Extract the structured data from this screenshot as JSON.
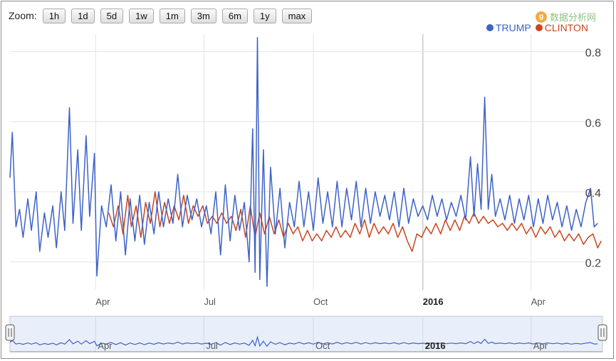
{
  "zoom": {
    "label": "Zoom:",
    "buttons": [
      "1h",
      "1d",
      "5d",
      "1w",
      "1m",
      "3m",
      "6m",
      "1y",
      "max"
    ]
  },
  "watermark": {
    "icon": "g",
    "text": "数据分析网"
  },
  "colors": {
    "trump": "#3d62c8",
    "clinton": "#c8461e",
    "grid": "#e4e4e4",
    "navigator_fill": "#e9effa"
  },
  "chart_data": {
    "type": "line",
    "legend_position": "top-right",
    "grid": true,
    "x_axis": {
      "type": "datetime",
      "range": [
        "2015-01-19",
        "2016-05-31"
      ],
      "ticks": [
        {
          "date": "2015-04-01",
          "label": "Apr",
          "bold": false
        },
        {
          "date": "2015-07-01",
          "label": "Jul",
          "bold": false
        },
        {
          "date": "2015-10-01",
          "label": "Oct",
          "bold": false
        },
        {
          "date": "2016-01-01",
          "label": "2016",
          "bold": true
        },
        {
          "date": "2016-04-01",
          "label": "Apr",
          "bold": false
        }
      ]
    },
    "y_axis": {
      "range": [
        0.12,
        0.85
      ],
      "ticks": [
        0.2,
        0.4,
        0.6,
        0.8
      ],
      "tick_labels": [
        "0.2",
        "0.4",
        "0.6",
        "0.8"
      ]
    },
    "series": [
      {
        "name": "TRUMP",
        "color": "#3d62c8",
        "points": [
          [
            "2015-01-19",
            0.44
          ],
          [
            "2015-01-21",
            0.57
          ],
          [
            "2015-01-24",
            0.3
          ],
          [
            "2015-01-27",
            0.35
          ],
          [
            "2015-01-30",
            0.27
          ],
          [
            "2015-02-03",
            0.38
          ],
          [
            "2015-02-06",
            0.29
          ],
          [
            "2015-02-10",
            0.4
          ],
          [
            "2015-02-13",
            0.23
          ],
          [
            "2015-02-17",
            0.34
          ],
          [
            "2015-02-20",
            0.27
          ],
          [
            "2015-02-24",
            0.36
          ],
          [
            "2015-02-27",
            0.24
          ],
          [
            "2015-03-03",
            0.4
          ],
          [
            "2015-03-06",
            0.29
          ],
          [
            "2015-03-10",
            0.64
          ],
          [
            "2015-03-13",
            0.31
          ],
          [
            "2015-03-17",
            0.52
          ],
          [
            "2015-03-20",
            0.29
          ],
          [
            "2015-03-24",
            0.56
          ],
          [
            "2015-03-27",
            0.33
          ],
          [
            "2015-03-31",
            0.51
          ],
          [
            "2015-04-02",
            0.16
          ],
          [
            "2015-04-06",
            0.36
          ],
          [
            "2015-04-10",
            0.3
          ],
          [
            "2015-04-14",
            0.42
          ],
          [
            "2015-04-18",
            0.26
          ],
          [
            "2015-04-22",
            0.4
          ],
          [
            "2015-04-26",
            0.22
          ],
          [
            "2015-04-30",
            0.38
          ],
          [
            "2015-05-04",
            0.26
          ],
          [
            "2015-05-08",
            0.39
          ],
          [
            "2015-05-12",
            0.25
          ],
          [
            "2015-05-16",
            0.37
          ],
          [
            "2015-05-20",
            0.28
          ],
          [
            "2015-05-24",
            0.4
          ],
          [
            "2015-05-28",
            0.3
          ],
          [
            "2015-06-01",
            0.38
          ],
          [
            "2015-06-05",
            0.31
          ],
          [
            "2015-06-09",
            0.45
          ],
          [
            "2015-06-13",
            0.3
          ],
          [
            "2015-06-17",
            0.39
          ],
          [
            "2015-06-21",
            0.32
          ],
          [
            "2015-06-25",
            0.38
          ],
          [
            "2015-06-29",
            0.3
          ],
          [
            "2015-07-03",
            0.36
          ],
          [
            "2015-07-07",
            0.28
          ],
          [
            "2015-07-11",
            0.4
          ],
          [
            "2015-07-15",
            0.22
          ],
          [
            "2015-07-19",
            0.42
          ],
          [
            "2015-07-23",
            0.26
          ],
          [
            "2015-07-27",
            0.39
          ],
          [
            "2015-07-31",
            0.29
          ],
          [
            "2015-08-04",
            0.37
          ],
          [
            "2015-08-08",
            0.2
          ],
          [
            "2015-08-11",
            0.58
          ],
          [
            "2015-08-13",
            0.17
          ],
          [
            "2015-08-15",
            0.84
          ],
          [
            "2015-08-17",
            0.15
          ],
          [
            "2015-08-20",
            0.52
          ],
          [
            "2015-08-23",
            0.13
          ],
          [
            "2015-08-26",
            0.47
          ],
          [
            "2015-08-30",
            0.28
          ],
          [
            "2015-09-03",
            0.41
          ],
          [
            "2015-09-07",
            0.24
          ],
          [
            "2015-09-11",
            0.37
          ],
          [
            "2015-09-15",
            0.3
          ],
          [
            "2015-09-19",
            0.43
          ],
          [
            "2015-09-23",
            0.3
          ],
          [
            "2015-09-27",
            0.4
          ],
          [
            "2015-10-01",
            0.29
          ],
          [
            "2015-10-05",
            0.44
          ],
          [
            "2015-10-09",
            0.31
          ],
          [
            "2015-10-13",
            0.4
          ],
          [
            "2015-10-17",
            0.3
          ],
          [
            "2015-10-21",
            0.43
          ],
          [
            "2015-10-25",
            0.3
          ],
          [
            "2015-10-29",
            0.41
          ],
          [
            "2015-11-02",
            0.32
          ],
          [
            "2015-11-06",
            0.43
          ],
          [
            "2015-11-10",
            0.3
          ],
          [
            "2015-11-14",
            0.41
          ],
          [
            "2015-11-18",
            0.31
          ],
          [
            "2015-11-22",
            0.4
          ],
          [
            "2015-11-26",
            0.33
          ],
          [
            "2015-11-30",
            0.39
          ],
          [
            "2015-12-04",
            0.32
          ],
          [
            "2015-12-08",
            0.4
          ],
          [
            "2015-12-12",
            0.3
          ],
          [
            "2015-12-16",
            0.41
          ],
          [
            "2015-12-20",
            0.31
          ],
          [
            "2015-12-24",
            0.38
          ],
          [
            "2015-12-28",
            0.33
          ],
          [
            "2016-01-01",
            0.36
          ],
          [
            "2016-01-05",
            0.32
          ],
          [
            "2016-01-09",
            0.39
          ],
          [
            "2016-01-13",
            0.33
          ],
          [
            "2016-01-17",
            0.38
          ],
          [
            "2016-01-21",
            0.32
          ],
          [
            "2016-01-25",
            0.37
          ],
          [
            "2016-01-29",
            0.33
          ],
          [
            "2016-02-02",
            0.39
          ],
          [
            "2016-02-06",
            0.32
          ],
          [
            "2016-02-10",
            0.5
          ],
          [
            "2016-02-13",
            0.33
          ],
          [
            "2016-02-16",
            0.48
          ],
          [
            "2016-02-19",
            0.35
          ],
          [
            "2016-02-22",
            0.67
          ],
          [
            "2016-02-25",
            0.35
          ],
          [
            "2016-02-28",
            0.45
          ],
          [
            "2016-03-02",
            0.33
          ],
          [
            "2016-03-06",
            0.38
          ],
          [
            "2016-03-10",
            0.32
          ],
          [
            "2016-03-14",
            0.39
          ],
          [
            "2016-03-18",
            0.31
          ],
          [
            "2016-03-22",
            0.38
          ],
          [
            "2016-03-26",
            0.32
          ],
          [
            "2016-03-30",
            0.39
          ],
          [
            "2016-04-03",
            0.3
          ],
          [
            "2016-04-07",
            0.38
          ],
          [
            "2016-04-11",
            0.31
          ],
          [
            "2016-04-15",
            0.39
          ],
          [
            "2016-04-19",
            0.32
          ],
          [
            "2016-04-23",
            0.37
          ],
          [
            "2016-04-27",
            0.3
          ],
          [
            "2016-05-01",
            0.36
          ],
          [
            "2016-05-05",
            0.29
          ],
          [
            "2016-05-09",
            0.35
          ],
          [
            "2016-05-13",
            0.3
          ],
          [
            "2016-05-17",
            0.37
          ],
          [
            "2016-05-21",
            0.41
          ],
          [
            "2016-05-24",
            0.3
          ],
          [
            "2016-05-27",
            0.31
          ]
        ]
      },
      {
        "name": "CLINTON",
        "color": "#c8461e",
        "points": [
          [
            "2015-04-12",
            0.34
          ],
          [
            "2015-04-16",
            0.3
          ],
          [
            "2015-04-20",
            0.36
          ],
          [
            "2015-04-24",
            0.28
          ],
          [
            "2015-04-28",
            0.39
          ],
          [
            "2015-05-01",
            0.3
          ],
          [
            "2015-05-05",
            0.36
          ],
          [
            "2015-05-09",
            0.27
          ],
          [
            "2015-05-13",
            0.37
          ],
          [
            "2015-05-17",
            0.31
          ],
          [
            "2015-05-21",
            0.4
          ],
          [
            "2015-05-25",
            0.3
          ],
          [
            "2015-05-29",
            0.37
          ],
          [
            "2015-06-02",
            0.31
          ],
          [
            "2015-06-06",
            0.36
          ],
          [
            "2015-06-10",
            0.32
          ],
          [
            "2015-06-14",
            0.39
          ],
          [
            "2015-06-18",
            0.31
          ],
          [
            "2015-06-22",
            0.36
          ],
          [
            "2015-06-26",
            0.33
          ],
          [
            "2015-06-30",
            0.36
          ],
          [
            "2015-07-04",
            0.31
          ],
          [
            "2015-07-08",
            0.33
          ],
          [
            "2015-07-12",
            0.31
          ],
          [
            "2015-07-16",
            0.34
          ],
          [
            "2015-07-20",
            0.31
          ],
          [
            "2015-07-24",
            0.33
          ],
          [
            "2015-07-28",
            0.29
          ],
          [
            "2015-08-01",
            0.35
          ],
          [
            "2015-08-05",
            0.27
          ],
          [
            "2015-08-09",
            0.36
          ],
          [
            "2015-08-13",
            0.27
          ],
          [
            "2015-08-17",
            0.34
          ],
          [
            "2015-08-21",
            0.28
          ],
          [
            "2015-08-25",
            0.33
          ],
          [
            "2015-08-29",
            0.28
          ],
          [
            "2015-09-02",
            0.32
          ],
          [
            "2015-09-06",
            0.27
          ],
          [
            "2015-09-10",
            0.31
          ],
          [
            "2015-09-14",
            0.28
          ],
          [
            "2015-09-18",
            0.3
          ],
          [
            "2015-09-22",
            0.26
          ],
          [
            "2015-09-26",
            0.29
          ],
          [
            "2015-09-30",
            0.26
          ],
          [
            "2015-10-04",
            0.28
          ],
          [
            "2015-10-08",
            0.26
          ],
          [
            "2015-10-12",
            0.29
          ],
          [
            "2015-10-16",
            0.27
          ],
          [
            "2015-10-20",
            0.3
          ],
          [
            "2015-10-24",
            0.27
          ],
          [
            "2015-10-28",
            0.29
          ],
          [
            "2015-11-01",
            0.27
          ],
          [
            "2015-11-05",
            0.31
          ],
          [
            "2015-11-09",
            0.28
          ],
          [
            "2015-11-13",
            0.32
          ],
          [
            "2015-11-17",
            0.27
          ],
          [
            "2015-11-21",
            0.31
          ],
          [
            "2015-11-25",
            0.28
          ],
          [
            "2015-11-29",
            0.3
          ],
          [
            "2015-12-03",
            0.28
          ],
          [
            "2015-12-07",
            0.31
          ],
          [
            "2015-12-11",
            0.27
          ],
          [
            "2015-12-15",
            0.3
          ],
          [
            "2015-12-19",
            0.26
          ],
          [
            "2015-12-23",
            0.23
          ],
          [
            "2015-12-27",
            0.28
          ],
          [
            "2015-12-31",
            0.27
          ],
          [
            "2016-01-04",
            0.3
          ],
          [
            "2016-01-08",
            0.28
          ],
          [
            "2016-01-12",
            0.31
          ],
          [
            "2016-01-16",
            0.28
          ],
          [
            "2016-01-20",
            0.32
          ],
          [
            "2016-01-24",
            0.29
          ],
          [
            "2016-01-28",
            0.32
          ],
          [
            "2016-02-01",
            0.29
          ],
          [
            "2016-02-05",
            0.33
          ],
          [
            "2016-02-09",
            0.31
          ],
          [
            "2016-02-13",
            0.34
          ],
          [
            "2016-02-17",
            0.31
          ],
          [
            "2016-02-21",
            0.33
          ],
          [
            "2016-02-25",
            0.31
          ],
          [
            "2016-02-29",
            0.32
          ],
          [
            "2016-03-04",
            0.3
          ],
          [
            "2016-03-08",
            0.31
          ],
          [
            "2016-03-12",
            0.29
          ],
          [
            "2016-03-16",
            0.31
          ],
          [
            "2016-03-20",
            0.29
          ],
          [
            "2016-03-24",
            0.31
          ],
          [
            "2016-03-28",
            0.28
          ],
          [
            "2016-04-01",
            0.3
          ],
          [
            "2016-04-05",
            0.27
          ],
          [
            "2016-04-09",
            0.3
          ],
          [
            "2016-04-13",
            0.28
          ],
          [
            "2016-04-17",
            0.3
          ],
          [
            "2016-04-21",
            0.27
          ],
          [
            "2016-04-25",
            0.29
          ],
          [
            "2016-04-29",
            0.26
          ],
          [
            "2016-05-03",
            0.28
          ],
          [
            "2016-05-07",
            0.26
          ],
          [
            "2016-05-11",
            0.28
          ],
          [
            "2016-05-15",
            0.25
          ],
          [
            "2016-05-19",
            0.27
          ],
          [
            "2016-05-23",
            0.28
          ],
          [
            "2016-05-27",
            0.24
          ],
          [
            "2016-05-30",
            0.26
          ]
        ]
      }
    ],
    "navigator": {
      "labels": [
        "Apr",
        "Jul",
        "Oct",
        "2016",
        "Apr"
      ]
    }
  }
}
